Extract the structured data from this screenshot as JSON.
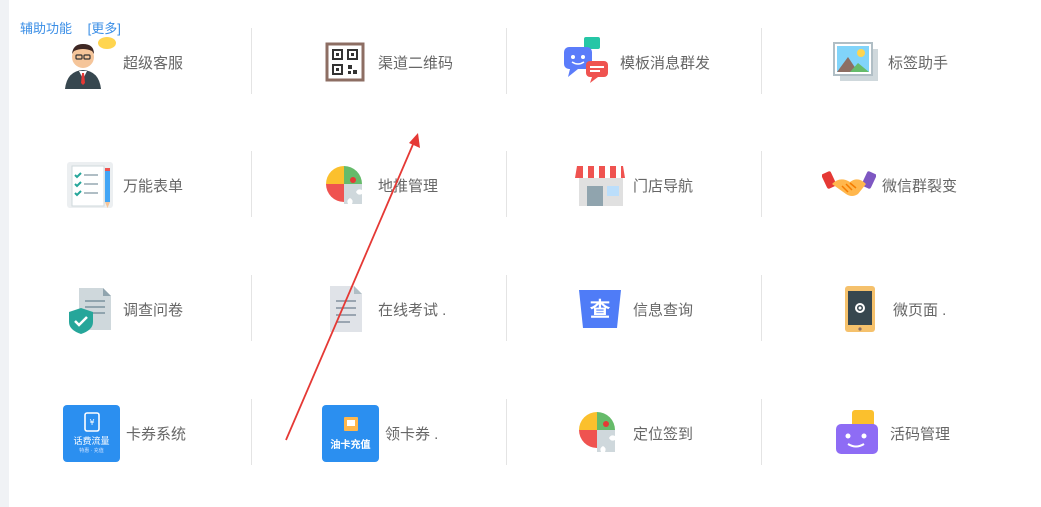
{
  "header": {
    "title": "辅助功能",
    "more": "[更多]"
  },
  "rows": [
    [
      {
        "label": "超级客服",
        "icon": "customer-service-icon"
      },
      {
        "label": "渠道二维码",
        "icon": "qr-code-icon"
      },
      {
        "label": "模板消息群发",
        "icon": "message-broadcast-icon"
      },
      {
        "label": "标签助手",
        "icon": "tag-helper-icon"
      }
    ],
    [
      {
        "label": "万能表单",
        "icon": "form-icon"
      },
      {
        "label": "地推管理",
        "icon": "puzzle-icon"
      },
      {
        "label": "门店导航",
        "icon": "store-icon"
      },
      {
        "label": "微信群裂变",
        "icon": "handshake-icon"
      }
    ],
    [
      {
        "label": "调查问卷",
        "icon": "survey-icon"
      },
      {
        "label": "在线考试 .",
        "icon": "document-icon"
      },
      {
        "label": "信息查询",
        "icon": "query-icon"
      },
      {
        "label": "微页面 .",
        "icon": "micro-page-icon"
      }
    ],
    [
      {
        "label": "卡券系统",
        "icon": "coupon-icon",
        "badge_line1": "话费流量",
        "badge_line2": "特惠 · 充值"
      },
      {
        "label": "领卡券 .",
        "icon": "fuel-card-icon",
        "badge_line1": "油卡充值"
      },
      {
        "label": "定位签到",
        "icon": "location-checkin-icon"
      },
      {
        "label": "活码管理",
        "icon": "live-code-icon"
      }
    ]
  ],
  "colors": {
    "link": "#3a8ee6",
    "label": "#666666",
    "arrow": "#e53935"
  }
}
